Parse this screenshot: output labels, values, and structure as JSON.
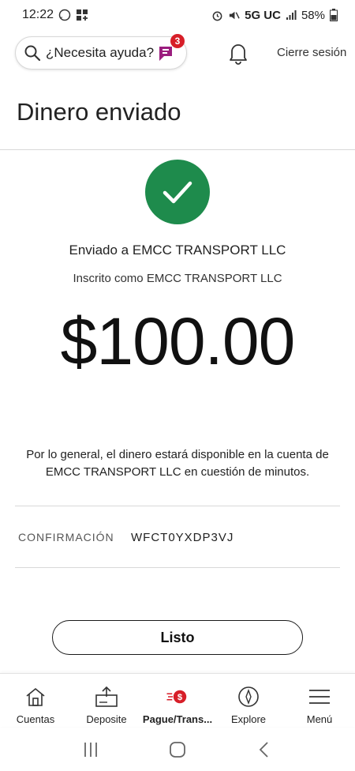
{
  "status_bar": {
    "time": "12:22",
    "network": "5G UC",
    "battery": "58%"
  },
  "header": {
    "help_label": "¿Necesita ayuda?",
    "assistant_badge_count": "3",
    "signout_label": "Cierre sesión"
  },
  "page": {
    "title": "Dinero enviado",
    "sent_to": "Enviado a EMCC TRANSPORT LLC",
    "enrolled_as": "Inscrito como EMCC TRANSPORT LLC",
    "amount": "$100.00",
    "note": "Por lo general, el dinero estará disponible en la cuenta de EMCC TRANSPORT LLC en cuestión de minutos.",
    "confirmation_label": "CONFIRMACIÓN",
    "confirmation_value": "WFCT0YXDP3VJ",
    "done_label": "Listo"
  },
  "bottom_nav": {
    "items": [
      {
        "label": "Cuentas",
        "icon": "home-icon"
      },
      {
        "label": "Deposite",
        "icon": "deposit-icon"
      },
      {
        "label": "Pague/Trans...",
        "icon": "pay-transfer-icon",
        "active": true
      },
      {
        "label": "Explore",
        "icon": "compass-icon"
      },
      {
        "label": "Menú",
        "icon": "hamburger-icon"
      }
    ]
  },
  "colors": {
    "success_green": "#1e8b4c",
    "brand_red": "#d71e28",
    "assistant_purple": "#9b1d7e"
  }
}
